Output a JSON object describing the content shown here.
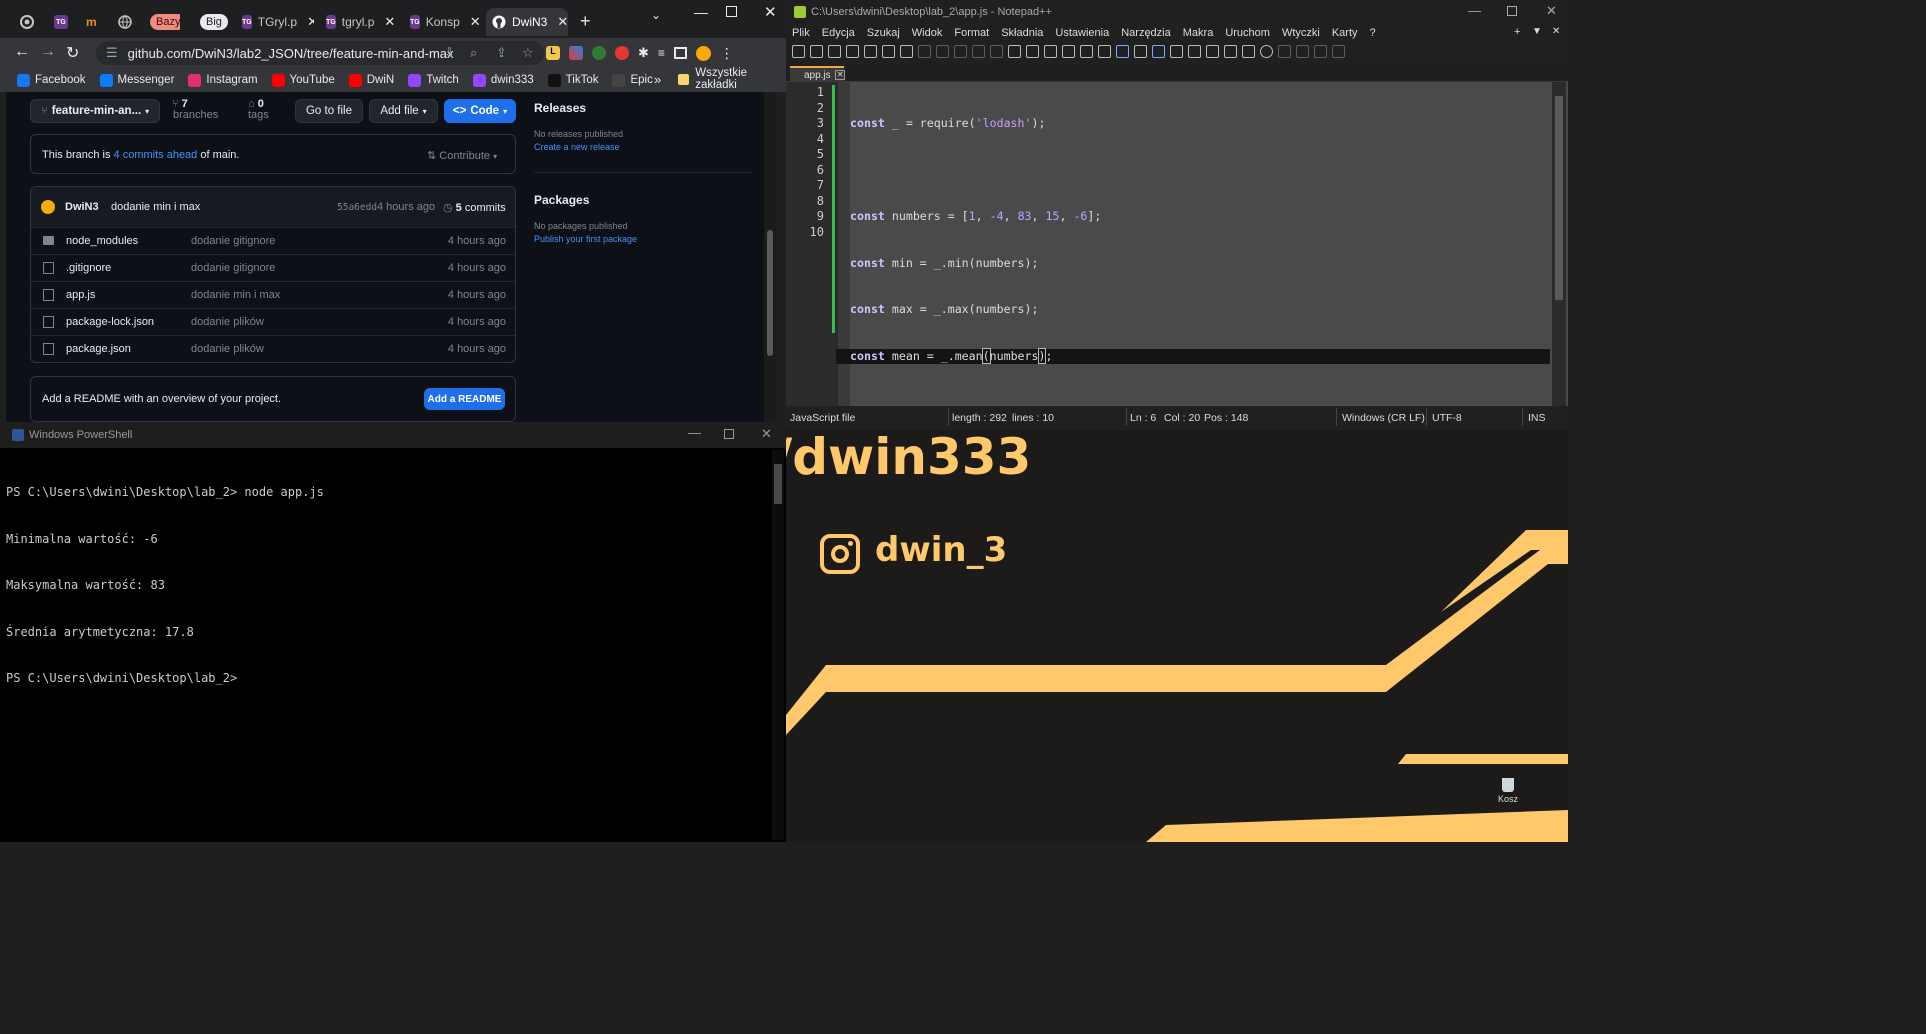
{
  "chrome": {
    "tabs": [
      {
        "label": "",
        "icon": "chrome-icon"
      },
      {
        "label": "",
        "icon": "tg-icon"
      },
      {
        "label": "",
        "icon": "m-icon"
      },
      {
        "label": "",
        "icon": "globe-icon"
      },
      {
        "label": "Bazy",
        "icon": "pill"
      },
      {
        "label": "Big",
        "icon": "pill"
      },
      {
        "label": "TGryl.p",
        "icon": "tg-icon"
      },
      {
        "label": "tgryl.p",
        "icon": "tg-icon"
      },
      {
        "label": "Konsp",
        "icon": "tg-icon"
      },
      {
        "label": "DwiN3",
        "icon": "github-icon"
      }
    ],
    "url": "github.com/DwiN3/lab2_JSON/tree/feature-min-and-max",
    "bookmarks": [
      {
        "label": "Facebook",
        "color": "#1877f2"
      },
      {
        "label": "Messenger",
        "color": "#0a7cff"
      },
      {
        "label": "Instagram",
        "color": "#e1306c"
      },
      {
        "label": "YouTube",
        "color": "#ff0000"
      },
      {
        "label": "DwiN",
        "color": "#ff0000"
      },
      {
        "label": "Twitch",
        "color": "#9146ff"
      },
      {
        "label": "dwin333",
        "color": "#9146ff"
      },
      {
        "label": "TikTok",
        "color": "#111111"
      },
      {
        "label": "Epic",
        "color": "#444444"
      }
    ],
    "bookmarks_more": "»",
    "all_bookmarks": "Wszystkie zakładki"
  },
  "github": {
    "branch_name": "feature-min-an...",
    "branches_count": "7",
    "branches_label": "branches",
    "tags_count": "0",
    "tags_label": "tags",
    "go_to_file": "Go to file",
    "add_file": "Add file",
    "code": "Code",
    "branch_info_pre": "This branch is ",
    "branch_info_link": "4 commits ahead",
    "branch_info_post": " of main.",
    "contribute": "Contribute",
    "commit_author": "DwiN3",
    "commit_message": "dodanie min i max",
    "commit_hash": "55a6edd",
    "commit_time": "4 hours ago",
    "commits_count": "5",
    "commits_label": "commits",
    "files": [
      {
        "name": "node_modules",
        "type": "dir",
        "message": "dodanie gitignore",
        "time": "4 hours ago"
      },
      {
        "name": ".gitignore",
        "type": "file",
        "message": "dodanie gitignore",
        "time": "4 hours ago"
      },
      {
        "name": "app.js",
        "type": "file",
        "message": "dodanie min i max",
        "time": "4 hours ago"
      },
      {
        "name": "package-lock.json",
        "type": "file",
        "message": "dodanie plików",
        "time": "4 hours ago"
      },
      {
        "name": "package.json",
        "type": "file",
        "message": "dodanie plików",
        "time": "4 hours ago"
      }
    ],
    "readme_text": "Add a README with an overview of your project.",
    "readme_button": "Add a README",
    "releases_title": "Releases",
    "releases_none": "No releases published",
    "releases_link": "Create a new release",
    "packages_title": "Packages",
    "packages_none": "No packages published",
    "packages_link": "Publish your first package"
  },
  "powershell": {
    "title": "Windows PowerShell",
    "lines": [
      "PS C:\\Users\\dwini\\Desktop\\lab_2> node app.js",
      "Minimalna wartość: -6",
      "Maksymalna wartość: 83",
      "Średnia arytmetyczna: 17.8",
      "PS C:\\Users\\dwini\\Desktop\\lab_2>"
    ]
  },
  "notepad": {
    "title": "C:\\Users\\dwini\\Desktop\\lab_2\\app.js - Notepad++",
    "menu": [
      "Plik",
      "Edycja",
      "Szukaj",
      "Widok",
      "Format",
      "Składnia",
      "Ustawienia",
      "Narzędzia",
      "Makra",
      "Uruchom",
      "Wtyczki",
      "Karty",
      "?"
    ],
    "tab_name": "app.js",
    "line_numbers": [
      "1",
      "2",
      "3",
      "4",
      "5",
      "6",
      "7",
      "8",
      "9",
      "10"
    ],
    "status": {
      "language": "JavaScript file",
      "length": "length : 292",
      "lines": "lines : 10",
      "ln": "Ln : 6",
      "col": "Col : 20",
      "pos": "Pos : 148",
      "eol": "Windows (CR LF)",
      "encoding": "UTF-8",
      "mode": "INS"
    }
  },
  "desktop": {
    "twitch_handle": "/dwin333",
    "instagram_handle": "dwin_3",
    "recycle_bin": "Kosz",
    "accent": "#ffc96b"
  }
}
